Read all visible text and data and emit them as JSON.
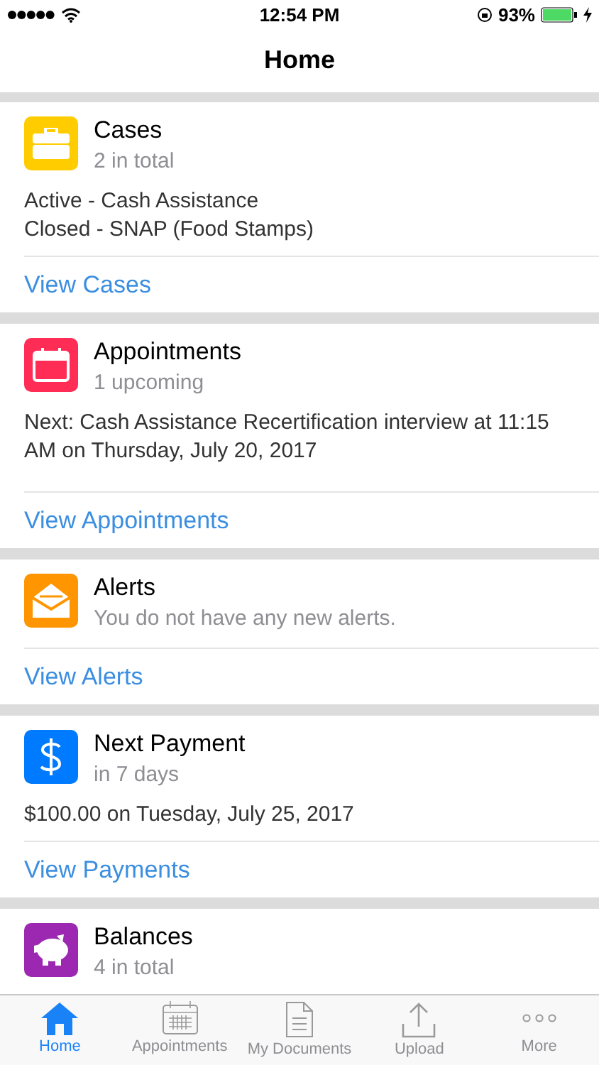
{
  "status_bar": {
    "time": "12:54 PM",
    "battery": "93%"
  },
  "nav": {
    "title": "Home"
  },
  "cards": [
    {
      "kind": "briefcase",
      "color": "#ffcc00",
      "title": "Cases",
      "subtitle": "2 in total",
      "details": [
        "Active - Cash Assistance",
        "Closed - SNAP (Food Stamps)"
      ],
      "link": "View Cases"
    },
    {
      "kind": "calendar",
      "color": "#ff2d55",
      "title": "Appointments",
      "subtitle": "1 upcoming",
      "details": [
        "Next: Cash Assistance Recertification interview at 11:15 AM on Thursday, July 20, 2017"
      ],
      "link": "View Appointments"
    },
    {
      "kind": "envelope",
      "color": "#ff9500",
      "title": "Alerts",
      "subtitle": "You do not have any new alerts.",
      "link": "View Alerts"
    },
    {
      "kind": "dollar",
      "color": "#007aff",
      "title": "Next Payment",
      "subtitle": "in 7 days",
      "details": [
        "$100.00 on Tuesday, July 25, 2017"
      ],
      "link": "View Payments"
    },
    {
      "kind": "piggy",
      "color": "#9c27b0",
      "title": "Balances",
      "subtitle": "4 in total"
    }
  ],
  "tabs": [
    {
      "kind": "home",
      "label": "Home",
      "selected": true
    },
    {
      "kind": "calendar",
      "label": "Appointments",
      "selected": false
    },
    {
      "kind": "document",
      "label": "My Documents",
      "selected": false
    },
    {
      "kind": "upload",
      "label": "Upload",
      "selected": false
    },
    {
      "kind": "more",
      "label": "More",
      "selected": false
    }
  ]
}
